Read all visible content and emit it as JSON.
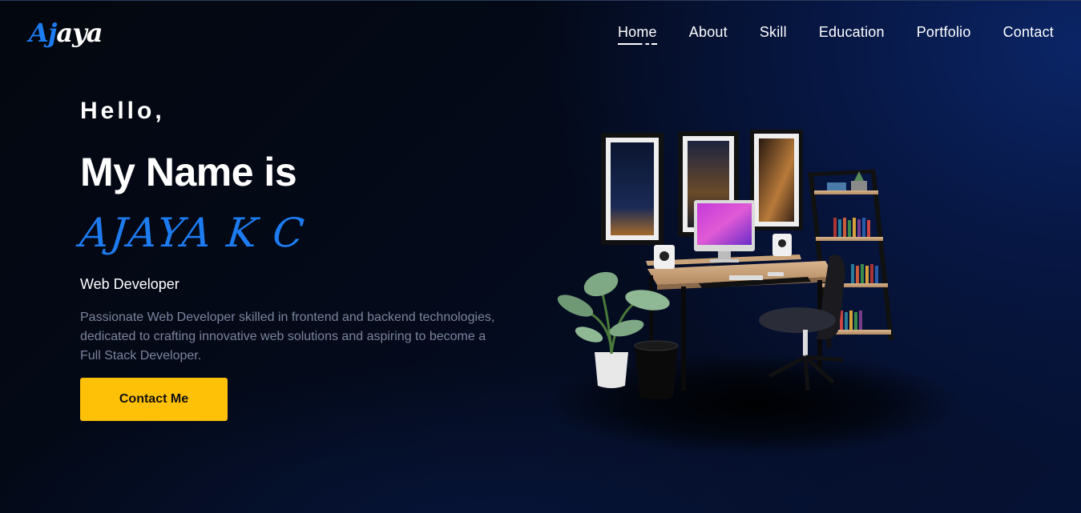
{
  "brand": {
    "logo_part1": "Aj",
    "logo_part2": "aya"
  },
  "nav": {
    "items": [
      {
        "label": "Home"
      },
      {
        "label": "About"
      },
      {
        "label": "Skill"
      },
      {
        "label": "Education"
      },
      {
        "label": "Portfolio"
      },
      {
        "label": "Contact"
      }
    ],
    "active": "Home"
  },
  "hero": {
    "greeting": "Hello,",
    "intro": "My Name is",
    "name": "AJAYA K C",
    "role": "Web Developer",
    "bio": "Passionate Web Developer skilled in frontend and backend technologies, dedicated to crafting innovative web solutions and aspiring to become a Full Stack Developer.",
    "cta_label": "Contact Me"
  },
  "colors": {
    "accent": "#1d7bf0",
    "button": "#ffc107",
    "background": "#040a1a",
    "muted_text": "#7a849c"
  }
}
